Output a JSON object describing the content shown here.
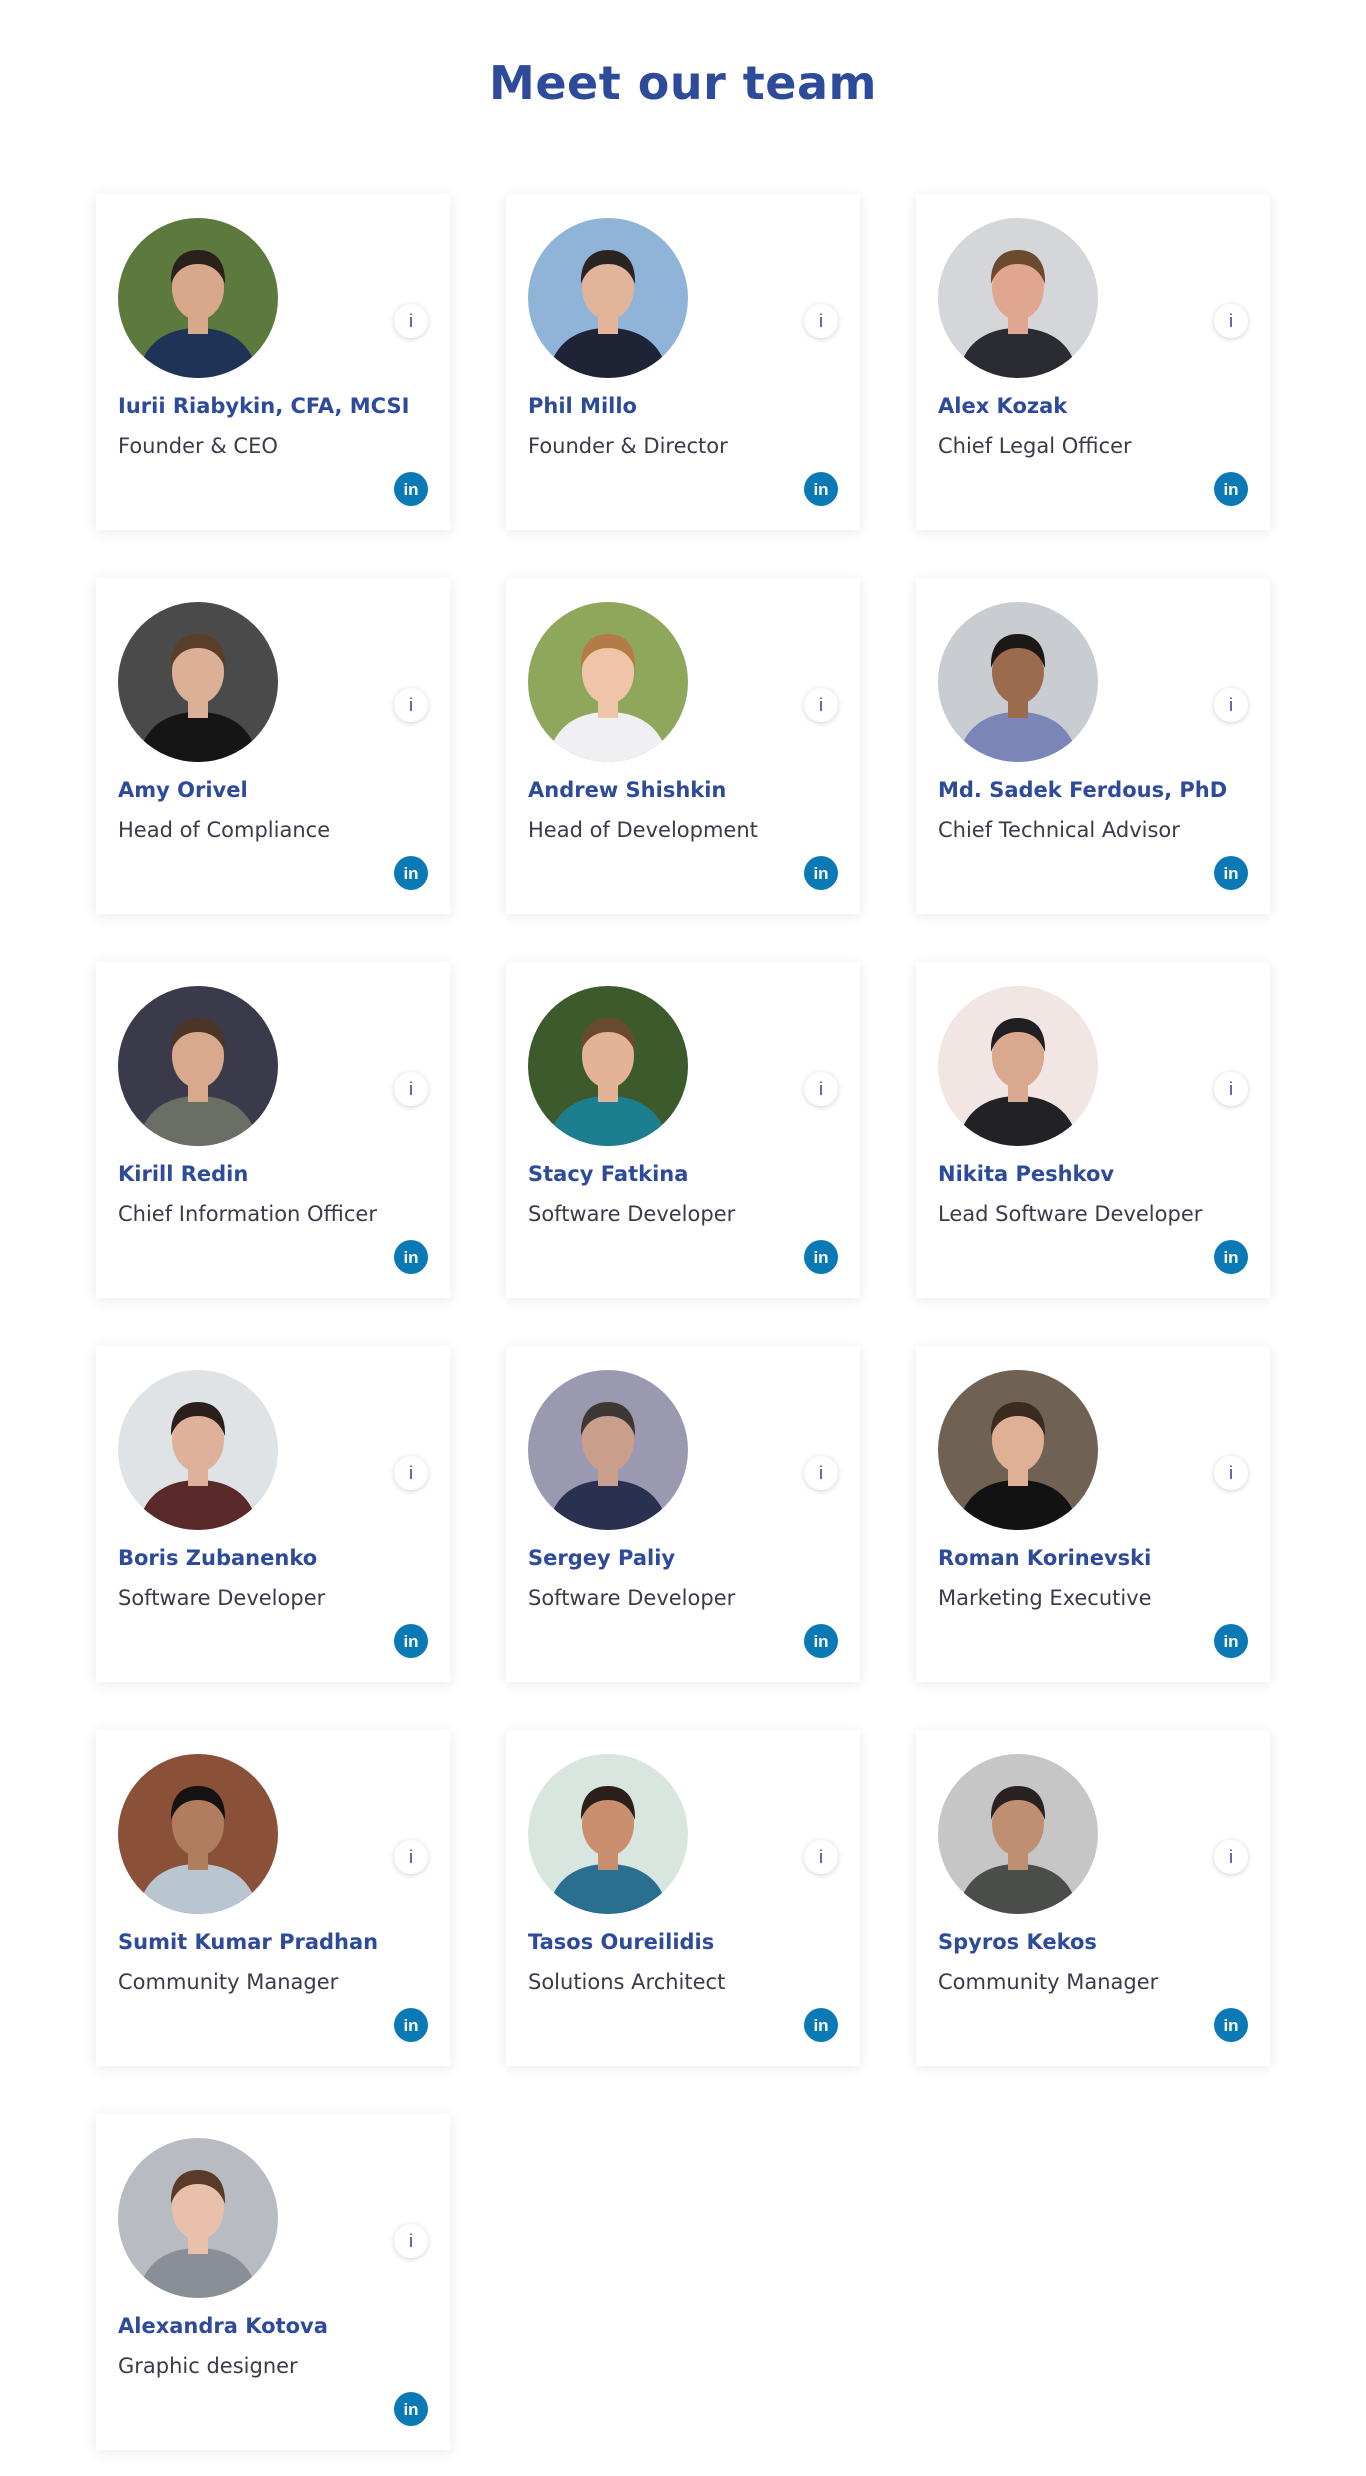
{
  "title": "Meet our team",
  "info_icon": "i",
  "linkedin_icon": "in",
  "colors": {
    "accent": "#2e4b9b",
    "text": "#3a3a4a",
    "linkedin": "#0a79b5"
  },
  "members": [
    {
      "name": "Iurii Riabykin, CFA, MCSI",
      "role": "Founder & CEO",
      "photo": {
        "bg": "#5d7a3e",
        "skin": "#d9a88b",
        "hair": "#2b211c",
        "shirt": "#1f3357"
      }
    },
    {
      "name": "Phil Millo",
      "role": "Founder & Director",
      "photo": {
        "bg": "#8fb4d8",
        "skin": "#e2b49a",
        "hair": "#2a2523",
        "shirt": "#1e2436"
      }
    },
    {
      "name": "Alex Kozak",
      "role": "Chief Legal Officer",
      "photo": {
        "bg": "#d4d6da",
        "skin": "#e0a690",
        "hair": "#6b4a2e",
        "shirt": "#2b2b33"
      }
    },
    {
      "name": "Amy Orivel",
      "role": "Head of Compliance",
      "photo": {
        "bg": "#4a4a4a",
        "skin": "#dcb097",
        "hair": "#5a3e2a",
        "shirt": "#151515"
      }
    },
    {
      "name": "Andrew Shishkin",
      "role": "Head of Development",
      "photo": {
        "bg": "#8ea75b",
        "skin": "#efc4a8",
        "hair": "#b37b45",
        "shirt": "#f0f0f2"
      }
    },
    {
      "name": "Md. Sadek Ferdous, PhD",
      "role": "Chief Technical Advisor",
      "photo": {
        "bg": "#c9cdd2",
        "skin": "#9c6b4e",
        "hair": "#1c1816",
        "shirt": "#7a86b8"
      }
    },
    {
      "name": "Kirill Redin",
      "role": "Chief Information Officer",
      "photo": {
        "bg": "#3b3a4a",
        "skin": "#d8a98c",
        "hair": "#4a3526",
        "shirt": "#6b6e64"
      }
    },
    {
      "name": "Stacy Fatkina",
      "role": "Software Developer",
      "photo": {
        "bg": "#3d5a2c",
        "skin": "#e3b396",
        "hair": "#6a4a2e",
        "shirt": "#1c7e8e"
      }
    },
    {
      "name": "Nikita Peshkov",
      "role": "Lead Software Developer",
      "photo": {
        "bg": "#f1e6e3",
        "skin": "#d9a88e",
        "hair": "#1f1f24",
        "shirt": "#222226"
      }
    },
    {
      "name": "Boris Zubanenko",
      "role": "Software Developer",
      "photo": {
        "bg": "#dfe3e6",
        "skin": "#dfb09a",
        "hair": "#2a1f1b",
        "shirt": "#5a2a2a"
      }
    },
    {
      "name": "Sergey Paliy",
      "role": "Software Developer",
      "photo": {
        "bg": "#9a99b0",
        "skin": "#caa08c",
        "hair": "#3e3834",
        "shirt": "#2a3050"
      }
    },
    {
      "name": "Roman Korinevski",
      "role": "Marketing Executive",
      "photo": {
        "bg": "#6f6253",
        "skin": "#e0b096",
        "hair": "#3a2a20",
        "shirt": "#121212"
      }
    },
    {
      "name": "Sumit Kumar Pradhan",
      "role": "Community Manager",
      "photo": {
        "bg": "#8a5038",
        "skin": "#b07d5e",
        "hair": "#141212",
        "shirt": "#b9c5d1"
      }
    },
    {
      "name": "Tasos Oureilidis",
      "role": "Solutions Architect",
      "photo": {
        "bg": "#d8e6df",
        "skin": "#c98e6e",
        "hair": "#2b2019",
        "shirt": "#2a6f8f"
      }
    },
    {
      "name": "Spyros Kekos",
      "role": "Community Manager",
      "photo": {
        "bg": "#c6c6c6",
        "skin": "#c08f72",
        "hair": "#2a2220",
        "shirt": "#4a4d4a"
      }
    },
    {
      "name": "Alexandra Kotova",
      "role": "Graphic designer",
      "photo": {
        "bg": "#b8bcc2",
        "skin": "#e9c0ab",
        "hair": "#5a3a28",
        "shirt": "#8a8e96"
      }
    }
  ]
}
